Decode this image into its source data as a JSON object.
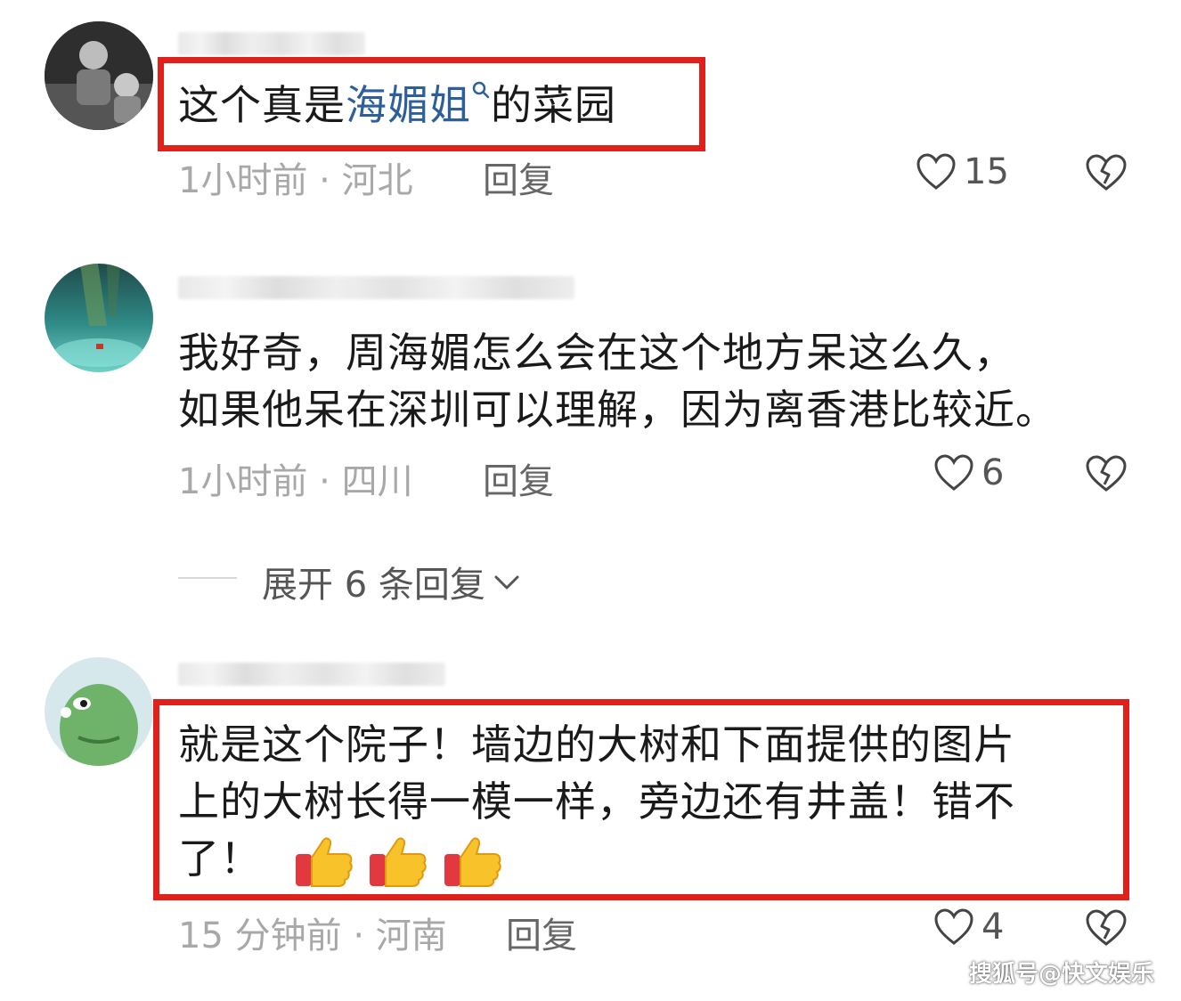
{
  "comments": [
    {
      "text_prefix": "这个真是",
      "link_text": "海媚姐",
      "text_suffix": "的菜园",
      "meta": "1小时前 · 河北",
      "reply_label": "回复",
      "likes": "15"
    },
    {
      "line1": "我好奇，周海媚怎么会在这个地方呆这么久，",
      "line2": "如果他呆在深圳可以理解，因为离香港比较近。",
      "meta": "1小时前 · 四川",
      "reply_label": "回复",
      "likes": "6"
    },
    {
      "line1": "就是这个院子！墙边的大树和下面提供的图片",
      "line2": "上的大树长得一模一样，旁边还有井盖！错不",
      "line3": "了！",
      "meta": "15 分钟前 · 河南",
      "reply_label": "回复",
      "likes": "4"
    }
  ],
  "expand_replies": "展开 6 条回复",
  "watermark": "搜狐号@快文娱乐",
  "colors": {
    "highlight_border": "#e0201b",
    "search_link": "#2d5f9b",
    "meta_text": "#a8a8a8"
  },
  "icons": [
    "search-icon",
    "heart-icon",
    "broken-heart-icon",
    "chevron-down-icon",
    "thumbs-up-emoji"
  ]
}
